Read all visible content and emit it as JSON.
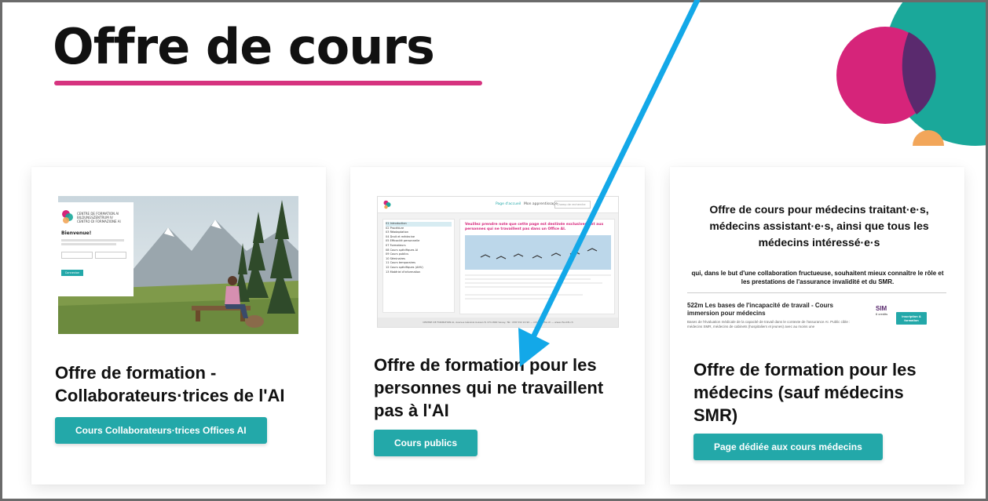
{
  "page": {
    "title": "Offre de cours"
  },
  "cards": [
    {
      "title": "Offre de formation - Collaborateurs·trices de l'AI",
      "button_label": "Cours Collaborateurs·trices Offices AI",
      "thumbnail": {
        "logo_lines": [
          "CENTRE DE FORMATION AI",
          "BILDUNGSZENTRUM IV",
          "CENTRO DI FORMAZIONE AI"
        ],
        "welcome": "Bienvenue!",
        "button": "Connexion"
      }
    },
    {
      "title": "Offre de formation pour les personnes qui ne travaillent pas à l'AI",
      "button_label": "Cours publics",
      "thumbnail": {
        "nav_home": "Page d'accueil",
        "nav_learning": "Mon apprentissage",
        "search_placeholder": "Champ de recherche",
        "notice": "Veuillez prendre note que cette page est destinée exclusivement aux personnes qui ne travaillent pas dans un Office AI.",
        "menu_items": [
          "01 Introduction",
          "02 Procédure",
          "03 Réadaptation",
          "04 Droit et médecine",
          "05 Efficacité personnelle",
          "07 Formateurs",
          "08 Cours spécifiques AI",
          "09 Cours publics",
          "10 Séminaires",
          "11 Cours temporaires",
          "12 Cours spécifiques (AHV)",
          "13 Matériel d'information"
        ],
        "footer": "CENTRE DE FORMATION AI, Avenue Général-Guisan 8, CH-1800 Vevey, Tél : 058 532 22 90 — info@iv-cfai.ch — www.cfai-bfz.ch"
      }
    },
    {
      "title": "Offre de formation pour les médecins (sauf médecins SMR)",
      "button_label": "Page dédiée aux cours médecins",
      "preview": {
        "heading": "Offre de cours pour médecins traitant·e·s, médecins assistant·e·s, ainsi que tous les médecins intéressé·e·s",
        "subheading": "qui, dans le but d'une collaboration fructueuse, souhaitent mieux connaître le rôle et les prestations de l'assurance invalidité et du SMR.",
        "course_title": "522m Les bases de l'incapacité de travail - Cours immersion pour médecins",
        "course_desc": "Bases de l'évaluation médicale de la capacité de travail dans le contexte de l'assurance AI. Public cible : médecins SMR, médecins de cabinets (hospitaliers et jeunes) avec au moins une",
        "credits": "6 credits",
        "logo_text": "SIM",
        "register_button": "Inscription & formation"
      }
    }
  ],
  "colors": {
    "accent_teal": "#23a8a9",
    "underline_pink": "#d6337f",
    "arrow_blue": "#13a8e8",
    "deco_magenta": "#d6247a",
    "deco_teal": "#1aa89a",
    "deco_purple": "#5a2a6e",
    "deco_orange": "#f2a65a"
  }
}
